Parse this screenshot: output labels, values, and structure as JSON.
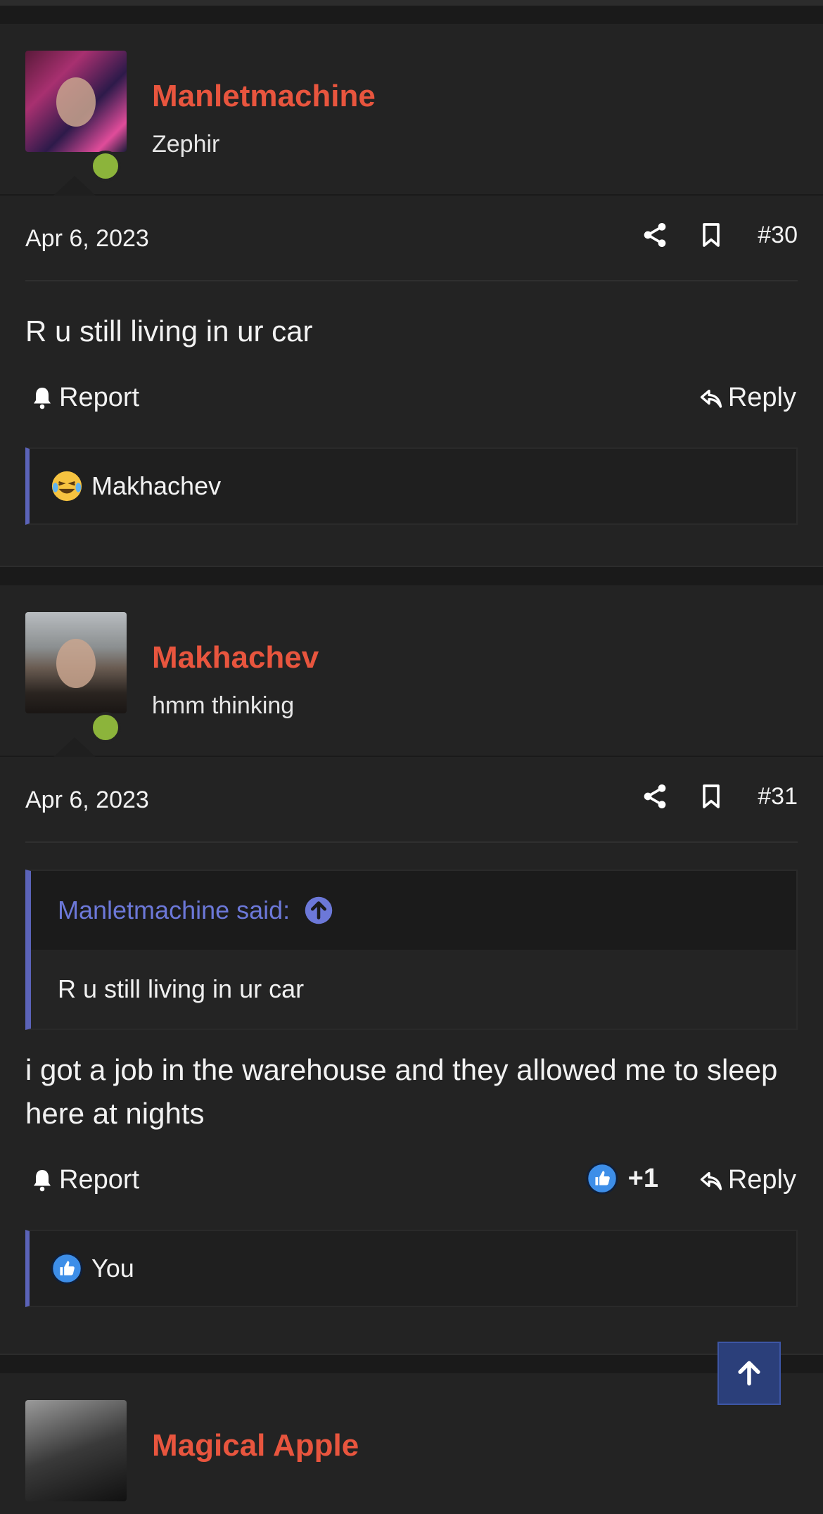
{
  "posts": [
    {
      "username": "Manletmachine",
      "user_title": "Zephir",
      "date": "Apr 6, 2023",
      "post_number": "#30",
      "body": "R u still living in ur car",
      "report_label": "Report",
      "reply_label": "Reply",
      "reactions": {
        "emoji": "laughing-crying-emoji",
        "users": "Makhachev"
      }
    },
    {
      "username": "Makhachev",
      "user_title": "hmm thinking",
      "date": "Apr 6, 2023",
      "post_number": "#31",
      "quote": {
        "author_line": "Manletmachine said:",
        "text": "R u still living in ur car"
      },
      "body": "i got a job in the warehouse and they allowed me to sleep here at nights",
      "report_label": "Report",
      "like_count": "+1",
      "reply_label": "Reply",
      "reactions": {
        "emoji": "thumbs-up-icon",
        "users": "You"
      }
    },
    {
      "username": "Magical Apple"
    }
  ],
  "colors": {
    "username": "#e8553e",
    "accent": "#5b63b8",
    "online": "#8cb43b",
    "background": "#1a1a1a",
    "post_background": "#232323"
  }
}
